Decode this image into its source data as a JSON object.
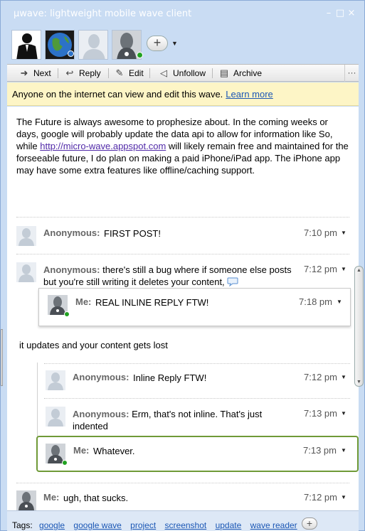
{
  "window": {
    "title": "µwave: lightweight mobile wave client",
    "controls": [
      "–",
      "□",
      "×"
    ]
  },
  "toolbar": {
    "next": "Next",
    "reply": "Reply",
    "edit": "Edit",
    "unfollow": "Unfollow",
    "archive": "Archive",
    "more": "···"
  },
  "notice": {
    "text": "Anyone on the internet can view and edit this wave.",
    "link": "Learn more"
  },
  "root": {
    "text_before_link": "The Future is always awesome to prophesize about. In the coming weeks or days, google will probably update the data api to allow for information like So, while ",
    "link": "http://micro-wave.appspot.com",
    "text_after_link": " will likely remain free and maintained for the forseeable future, I do plan on making a paid iPhone/iPad app. The iPhone app may have some extra features like offline/caching support."
  },
  "blips": [
    {
      "author": "Anonymous:",
      "text": "FIRST POST!",
      "time": "7:10 pm"
    },
    {
      "author": "Anonymous:",
      "text": "there's still a bug where if someone else posts but you're still writing it deletes your content,",
      "time": "7:12 pm"
    },
    {
      "author": "Me:",
      "text": "REAL INLINE REPLY FTW!",
      "time": "7:18 pm"
    },
    {
      "text": "it updates and your content gets lost"
    },
    {
      "author": "Anonymous:",
      "text": "Inline Reply FTW!",
      "time": "7:12 pm"
    },
    {
      "author": "Anonymous:",
      "text": "Erm, that's not inline. That's just indented",
      "time": "7:13 pm"
    },
    {
      "author": "Me:",
      "text": "Whatever.",
      "time": "7:13 pm"
    },
    {
      "author": "Me:",
      "text": "ugh, that sucks.",
      "time": "7:12 pm"
    }
  ],
  "tags": {
    "label": "Tags:",
    "items": [
      "google",
      "google wave",
      "project",
      "screenshot",
      "update",
      "wave reader"
    ],
    "add": "+"
  },
  "colors": {
    "online": "#21a121",
    "focus_border": "#6f9a37",
    "link": "#1b57b5",
    "visited_link": "#5029a8"
  },
  "icons": {
    "next": "arrow-right-icon",
    "reply": "reply-icon",
    "edit": "pencil-icon",
    "unfollow": "speaker-mute-icon",
    "archive": "archive-icon",
    "inline_comment": "speech-bubble-icon"
  }
}
